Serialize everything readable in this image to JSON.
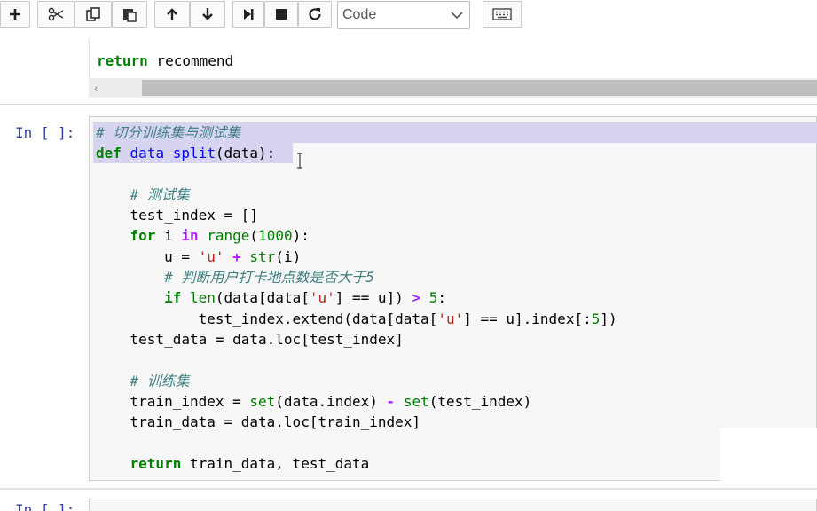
{
  "toolbar": {
    "buttons": [
      {
        "name": "insert-cell-below",
        "icon": "plus-icon"
      },
      {
        "name": "cut-cells",
        "icon": "scissors-icon"
      },
      {
        "name": "copy-cells",
        "icon": "copy-icon"
      },
      {
        "name": "paste-cells",
        "icon": "paste-icon"
      },
      {
        "name": "move-cell-up",
        "icon": "arrow-up-icon"
      },
      {
        "name": "move-cell-down",
        "icon": "arrow-down-icon"
      },
      {
        "name": "run-cell",
        "icon": "step-forward-icon"
      },
      {
        "name": "interrupt-kernel",
        "icon": "stop-icon"
      },
      {
        "name": "restart-kernel",
        "icon": "refresh-icon"
      },
      {
        "name": "command-palette",
        "icon": "keyboard-icon"
      }
    ],
    "cell_type": "Code"
  },
  "previous_cell": {
    "code_line": "return recommend"
  },
  "current_cell": {
    "prompt": "In [ ]:",
    "lines": [
      "# 切分训练集与测试集",
      "def data_split(data):",
      "",
      "    # 测试集",
      "    test_index = []",
      "    for i in range(1000):",
      "        u = 'u' + str(i)",
      "        # 判断用户打卡地点数是否大于5",
      "        if len(data[data['u'] == u]) > 5:",
      "            test_index.extend(data[data['u'] == u].index[:5])",
      "    test_data = data.loc[test_index]",
      "",
      "    # 训练集",
      "    train_index = set(data.index) - set(test_index)",
      "    train_data = data.loc[train_index]",
      "",
      "    return train_data, test_data"
    ]
  },
  "next_cell": {
    "prompt": "In [ ]:"
  },
  "colors": {
    "keyword": "#008000",
    "function_name": "#0000ff",
    "string": "#ba2121",
    "comment": "#408080",
    "operator": "#aa22ff",
    "prompt": "#303f9f",
    "selection": "#d7d4f0"
  }
}
